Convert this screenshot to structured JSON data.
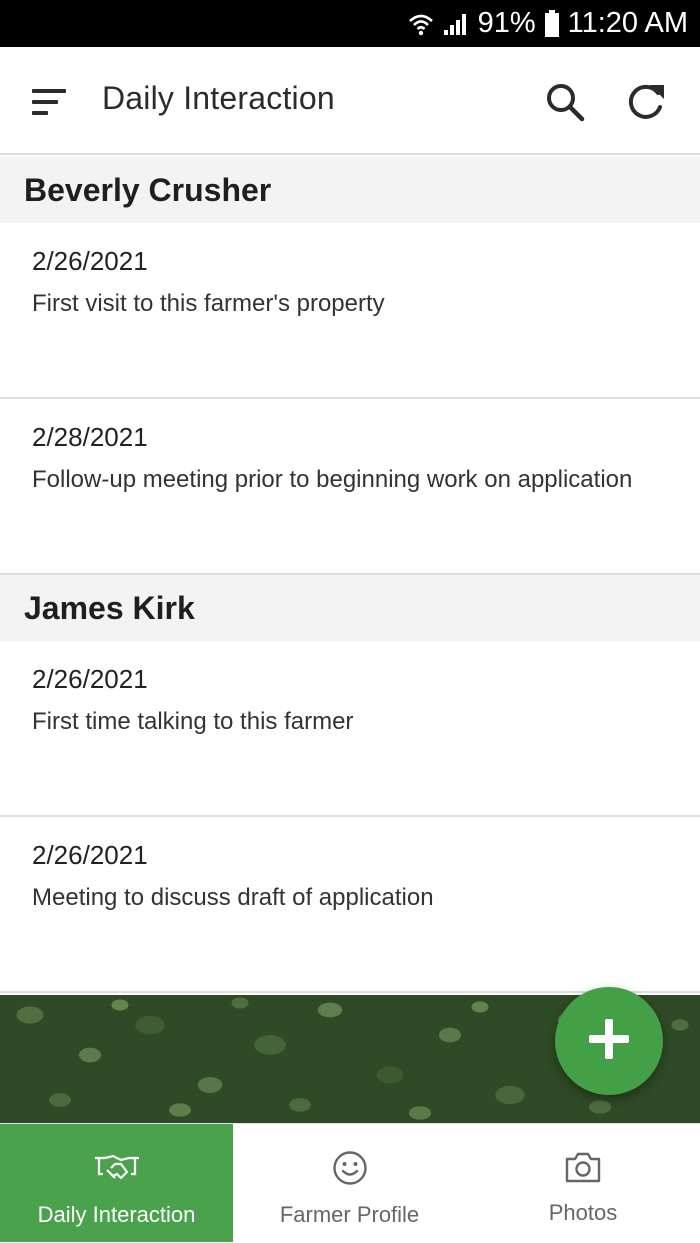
{
  "status_bar": {
    "battery": "91%",
    "time": "11:20 AM"
  },
  "app_bar": {
    "title": "Daily Interaction",
    "icons": [
      "menu-icon",
      "search-icon",
      "refresh-icon"
    ]
  },
  "groups": [
    {
      "name": "Beverly Crusher",
      "entries": [
        {
          "date": "2/26/2021",
          "description": "First visit to this farmer's property"
        },
        {
          "date": "2/28/2021",
          "description": "Follow-up meeting prior to beginning work on application"
        }
      ]
    },
    {
      "name": "James Kirk",
      "entries": [
        {
          "date": "2/26/2021",
          "description": "First time talking to this farmer"
        },
        {
          "date": "2/26/2021",
          "description": "Meeting to discuss draft of application"
        }
      ]
    }
  ],
  "fab": {
    "icon": "plus-icon"
  },
  "bottom_nav": {
    "items": [
      {
        "label": "Daily Interaction",
        "icon": "handshake-icon",
        "active": true
      },
      {
        "label": "Farmer Profile",
        "icon": "smiley-icon",
        "active": false
      },
      {
        "label": "Photos",
        "icon": "camera-icon",
        "active": false
      }
    ]
  },
  "colors": {
    "accent": "#43a046",
    "nav_active": "#4ba24d",
    "status_bar": "#000000"
  }
}
